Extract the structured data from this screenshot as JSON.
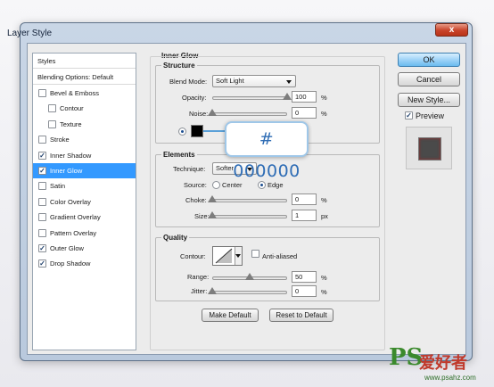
{
  "window": {
    "title": "Layer Style",
    "close_glyph": "x"
  },
  "styles_panel": {
    "header": "Styles",
    "blending": "Blending Options: Default",
    "items": [
      {
        "label": "Bevel & Emboss",
        "checked": false,
        "indent": 0
      },
      {
        "label": "Contour",
        "checked": false,
        "indent": 1
      },
      {
        "label": "Texture",
        "checked": false,
        "indent": 1
      },
      {
        "label": "Stroke",
        "checked": false,
        "indent": 0
      },
      {
        "label": "Inner Shadow",
        "checked": true,
        "indent": 0
      },
      {
        "label": "Inner Glow",
        "checked": true,
        "indent": 0,
        "selected": true
      },
      {
        "label": "Satin",
        "checked": false,
        "indent": 0
      },
      {
        "label": "Color Overlay",
        "checked": false,
        "indent": 0
      },
      {
        "label": "Gradient Overlay",
        "checked": false,
        "indent": 0
      },
      {
        "label": "Pattern Overlay",
        "checked": false,
        "indent": 0
      },
      {
        "label": "Outer Glow",
        "checked": true,
        "indent": 0
      },
      {
        "label": "Drop Shadow",
        "checked": true,
        "indent": 0
      }
    ],
    "check_glyph": "✓"
  },
  "inner_glow": {
    "title": "Inner Glow",
    "structure": {
      "title": "Structure",
      "blend_mode_label": "Blend Mode:",
      "blend_mode_value": "Soft Light",
      "opacity_label": "Opacity:",
      "opacity_value": "100",
      "opacity_unit": "%",
      "opacity_level": 1.0,
      "noise_label": "Noise:",
      "noise_value": "0",
      "noise_unit": "%",
      "noise_level": 0.0,
      "glow_color": "#000000"
    },
    "elements": {
      "title": "Elements",
      "technique_label": "Technique:",
      "technique_value": "Softer",
      "source_label": "Source:",
      "source_center": "Center",
      "source_edge": "Edge",
      "source_selected": "Edge",
      "choke_label": "Choke:",
      "choke_value": "0",
      "choke_unit": "%",
      "choke_level": 0.0,
      "size_label": "Size:",
      "size_value": "1",
      "size_unit": "px",
      "size_level": 0.0
    },
    "quality": {
      "title": "Quality",
      "contour_label": "Contour:",
      "anti_aliased_label": "Anti-aliased",
      "anti_aliased_checked": false,
      "range_label": "Range:",
      "range_value": "50",
      "range_unit": "%",
      "range_level": 0.5,
      "jitter_label": "Jitter:",
      "jitter_value": "0",
      "jitter_unit": "%",
      "jitter_level": 0.0
    },
    "make_default": "Make Default",
    "reset_default": "Reset to Default"
  },
  "tooltip_hex": "# 000000",
  "buttons": {
    "ok": "OK",
    "cancel": "Cancel",
    "new_style": "New Style...",
    "preview": "Preview"
  },
  "preview_checked": true,
  "watermark": {
    "ps": "PS",
    "cn": "爱好者",
    "url": "www.psahz.com"
  },
  "colors": {
    "accent": "#3399ff",
    "title_bar": "#c9d6e6",
    "close": "#c8432a",
    "watermark_green": "#3b8a2d",
    "watermark_red": "#c0392b"
  },
  "icons": [
    "close-icon",
    "checkmark-icon",
    "chevron-down-icon",
    "color-swatch-icon",
    "contour-curve-icon",
    "preview-thumbnail-icon"
  ]
}
